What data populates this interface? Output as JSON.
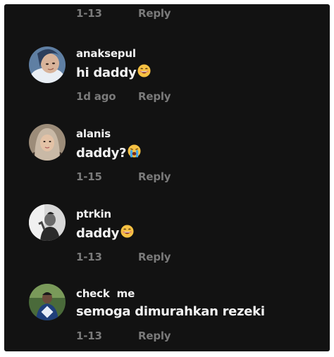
{
  "top_meta": {
    "date": "1-13",
    "reply": "Reply"
  },
  "comments": [
    {
      "username": "anaksepul",
      "text": "hi daddy",
      "emoji": "grinning-face-icon",
      "date": "1d ago",
      "reply": "Reply"
    },
    {
      "username": "alanis",
      "text": "daddy?",
      "emoji": "crying-face-icon",
      "date": "1-15",
      "reply": "Reply"
    },
    {
      "username": "ptrkin",
      "text": "daddy",
      "emoji": "grinning-face-icon",
      "date": "1-13",
      "reply": "Reply"
    },
    {
      "username": "check  me",
      "text": "semoga dimurahkan rezeki",
      "emoji": "",
      "date": "1-13",
      "reply": "Reply"
    }
  ],
  "colors": {
    "background": "#121212",
    "text_primary": "#f2f2f2",
    "text_secondary": "#7a7a7a"
  }
}
